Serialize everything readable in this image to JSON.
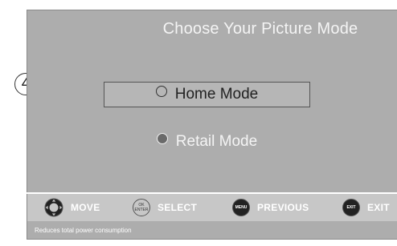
{
  "step_number": "4",
  "screen": {
    "title": "Choose Your Picture Mode",
    "options": [
      {
        "label": "Home Mode",
        "selected": true
      },
      {
        "label": "Retail Mode",
        "selected": false
      }
    ]
  },
  "navbar": {
    "move": {
      "label": "MOVE",
      "icon": "dpad-icon"
    },
    "select": {
      "label": "SELECT",
      "icon": "ok-enter-icon",
      "icon_text_1": "OK",
      "icon_text_2": "ENTER"
    },
    "previous": {
      "label": "PREVIOUS",
      "icon": "menu-button-icon",
      "icon_text": "MENU"
    },
    "exit": {
      "label": "EXIT",
      "icon": "exit-button-icon",
      "icon_text": "EXIT"
    }
  },
  "status": {
    "text": "Reduces total power consumption"
  }
}
